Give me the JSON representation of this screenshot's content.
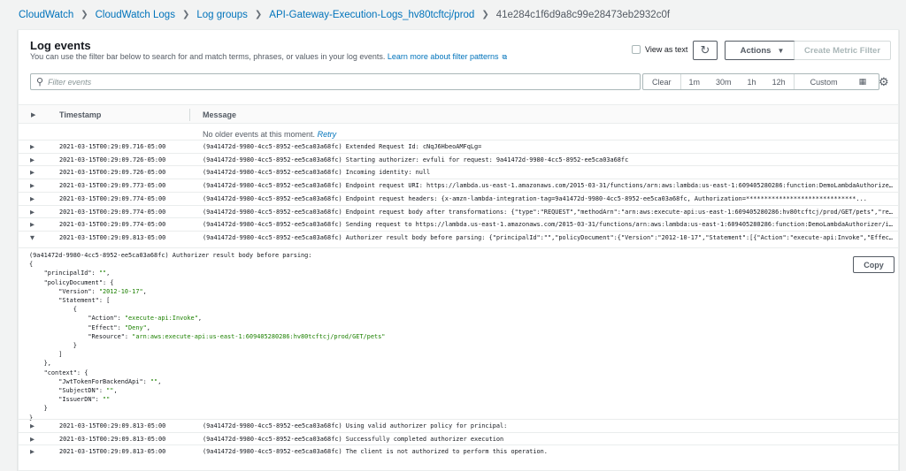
{
  "breadcrumb": [
    {
      "label": "CloudWatch",
      "link": true
    },
    {
      "label": "CloudWatch Logs",
      "link": true
    },
    {
      "label": "Log groups",
      "link": true
    },
    {
      "label": "API-Gateway-Execution-Logs_hv80tcftcj/prod",
      "link": true
    },
    {
      "label": "41e284c1f6d9a8c99e28473eb2932c0f",
      "link": false
    }
  ],
  "panel": {
    "title": "Log events",
    "description": "You can use the filter bar below to search for and match terms, phrases, or values in your log events.",
    "learn_more": "Learn more about filter patterns",
    "view_as_text": "View as text",
    "actions_label": "Actions",
    "create_metric_filter": "Create Metric Filter"
  },
  "filter": {
    "placeholder": "Filter events",
    "clear": "Clear",
    "ranges": [
      "1m",
      "30m",
      "1h",
      "12h"
    ],
    "custom": "Custom"
  },
  "table": {
    "col_timestamp": "Timestamp",
    "col_message": "Message",
    "older_text": "No older events at this moment.",
    "retry": "Retry"
  },
  "rows": [
    {
      "ts": "2021-03-15T00:29:09.716-05:00",
      "msg": "(9a41472d-9980-4cc5-8952-ee5ca03a68fc) Extended Request Id: cNqJ6HbeoAMFqLg="
    },
    {
      "ts": "2021-03-15T00:29:09.726-05:00",
      "msg": "(9a41472d-9980-4cc5-8952-ee5ca03a68fc) Starting authorizer: evfuli for request: 9a41472d-9980-4cc5-8952-ee5ca03a68fc"
    },
    {
      "ts": "2021-03-15T00:29:09.726-05:00",
      "msg": "(9a41472d-9980-4cc5-8952-ee5ca03a68fc) Incoming identity: null"
    },
    {
      "ts": "2021-03-15T00:29:09.773-05:00",
      "msg": "(9a41472d-9980-4cc5-8952-ee5ca03a68fc) Endpoint request URI: https://lambda.us-east-1.amazonaws.com/2015-03-31/functions/arn:aws:lambda:us-east-1:609405280286:function:DemoLambdaAuthorize..."
    },
    {
      "ts": "2021-03-15T00:29:09.774-05:00",
      "msg": "(9a41472d-9980-4cc5-8952-ee5ca03a68fc) Endpoint request headers: {x-amzn-lambda-integration-tag=9a41472d-9980-4cc5-8952-ee5ca03a68fc, Authorization=******************************..."
    },
    {
      "ts": "2021-03-15T00:29:09.774-05:00",
      "msg": "(9a41472d-9980-4cc5-8952-ee5ca03a68fc) Endpoint request body after transformations: {\"type\":\"REQUEST\",\"methodArn\":\"arn:aws:execute-api:us-east-1:609405280286:hv80tcftcj/prod/GET/pets\",\"re..."
    },
    {
      "ts": "2021-03-15T00:29:09.774-05:00",
      "msg": "(9a41472d-9980-4cc5-8952-ee5ca03a68fc) Sending request to https://lambda.us-east-1.amazonaws.com/2015-03-31/functions/arn:aws:lambda:us-east-1:609405280286:function:DemoLambdaAuthorizer/i..."
    },
    {
      "ts": "2021-03-15T00:29:09.813-05:00",
      "msg": "(9a41472d-9980-4cc5-8952-ee5ca03a68fc) Authorizer result body before parsing: {\"principalId\":\"\",\"policyDocument\":{\"Version\":\"2012-10-17\",\"Statement\":[{\"Action\":\"execute-api:Invoke\",\"Effec..."
    }
  ],
  "rows_after": [
    {
      "ts": "2021-03-15T00:29:09.813-05:00",
      "msg": "(9a41472d-9980-4cc5-8952-ee5ca03a68fc) Using valid authorizer policy for principal:"
    },
    {
      "ts": "2021-03-15T00:29:09.813-05:00",
      "msg": "(9a41472d-9980-4cc5-8952-ee5ca03a68fc) Successfully completed authorizer execution"
    },
    {
      "ts": "2021-03-15T00:29:09.813-05:00",
      "msg": "(9a41472d-9980-4cc5-8952-ee5ca03a68fc) The client is not authorized to perform this operation."
    }
  ],
  "expanded": {
    "header": "(9a41472d-9980-4cc5-8952-ee5ca03a68fc) Authorizer result body before parsing:",
    "principal_id": "\"\"",
    "version": "\"2012-10-17\"",
    "action": "\"execute-api:Invoke\"",
    "effect": "\"Deny\"",
    "resource": "\"arn:aws:execute-api:us-east-1:609405280286:hv80tcftcj/prod/GET/pets\"",
    "jwt": "\"\"",
    "subject": "\"\"",
    "issuer": "\"\"",
    "copy_label": "Copy"
  }
}
